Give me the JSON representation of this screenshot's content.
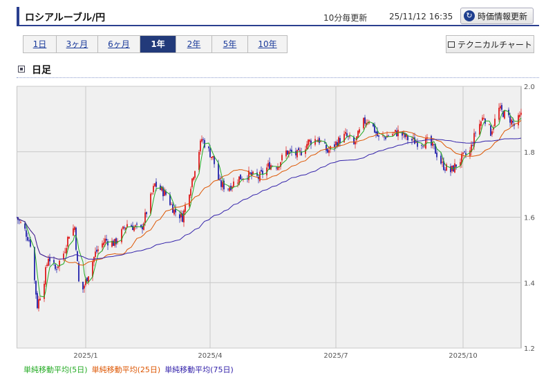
{
  "header": {
    "title": "ロシアルーブル/円",
    "update_note": "10分毎更新",
    "update_time": "25/11/12 16:35",
    "refresh_label": "時価情報更新"
  },
  "tabs": [
    {
      "label": "1日",
      "active": false
    },
    {
      "label": "3ヶ月",
      "active": false
    },
    {
      "label": "6ヶ月",
      "active": false
    },
    {
      "label": "1年",
      "active": true
    },
    {
      "label": "2年",
      "active": false
    },
    {
      "label": "5年",
      "active": false
    },
    {
      "label": "10年",
      "active": false
    }
  ],
  "tech_chart_label": "テクニカルチャート",
  "section_label": "日足",
  "colors": {
    "up": "#dd1111",
    "down": "#1a1aa8",
    "ma5": "#22aa22",
    "ma25": "#dd5500",
    "ma75": "#3322aa",
    "plot_bg": "#f0f0f0"
  },
  "chart_data": {
    "type": "candlestick",
    "ylim": [
      1.2,
      2.0
    ],
    "yticks": [
      "2.0",
      "1.8",
      "1.6",
      "1.4",
      "1.2"
    ],
    "xticks": [
      "2025/1",
      "2025/4",
      "2025/7",
      "2025/10"
    ],
    "grid": true,
    "start": "2024-11-12",
    "end": "2025-11-12",
    "close_path": [
      [
        "2024-11-12",
        1.6
      ],
      [
        "2024-11-18",
        1.56
      ],
      [
        "2024-11-22",
        1.52
      ],
      [
        "2024-11-27",
        1.33
      ],
      [
        "2024-12-02",
        1.41
      ],
      [
        "2024-12-05",
        1.48
      ],
      [
        "2024-12-10",
        1.44
      ],
      [
        "2024-12-16",
        1.49
      ],
      [
        "2024-12-20",
        1.55
      ],
      [
        "2024-12-24",
        1.57
      ],
      [
        "2024-12-27",
        1.4
      ],
      [
        "2024-12-30",
        1.38
      ],
      [
        "2025-01-08",
        1.49
      ],
      [
        "2025-01-15",
        1.53
      ],
      [
        "2025-01-22",
        1.52
      ],
      [
        "2025-01-31",
        1.58
      ],
      [
        "2025-02-10",
        1.56
      ],
      [
        "2025-02-20",
        1.7
      ],
      [
        "2025-02-28",
        1.67
      ],
      [
        "2025-03-06",
        1.62
      ],
      [
        "2025-03-12",
        1.6
      ],
      [
        "2025-03-18",
        1.7
      ],
      [
        "2025-03-26",
        1.84
      ],
      [
        "2025-04-03",
        1.78
      ],
      [
        "2025-04-08",
        1.7
      ],
      [
        "2025-04-14",
        1.69
      ],
      [
        "2025-04-22",
        1.72
      ],
      [
        "2025-04-28",
        1.73
      ],
      [
        "2025-05-06",
        1.72
      ],
      [
        "2025-05-14",
        1.76
      ],
      [
        "2025-05-20",
        1.76
      ],
      [
        "2025-05-26",
        1.8
      ],
      [
        "2025-06-04",
        1.79
      ],
      [
        "2025-06-11",
        1.83
      ],
      [
        "2025-06-18",
        1.84
      ],
      [
        "2025-06-25",
        1.8
      ],
      [
        "2025-07-02",
        1.83
      ],
      [
        "2025-07-08",
        1.85
      ],
      [
        "2025-07-14",
        1.82
      ],
      [
        "2025-07-21",
        1.89
      ],
      [
        "2025-07-25",
        1.9
      ],
      [
        "2025-08-01",
        1.84
      ],
      [
        "2025-08-08",
        1.85
      ],
      [
        "2025-08-15",
        1.86
      ],
      [
        "2025-08-22",
        1.84
      ],
      [
        "2025-08-28",
        1.83
      ],
      [
        "2025-09-05",
        1.83
      ],
      [
        "2025-09-10",
        1.81
      ],
      [
        "2025-09-16",
        1.76
      ],
      [
        "2025-09-22",
        1.74
      ],
      [
        "2025-09-30",
        1.78
      ],
      [
        "2025-10-06",
        1.8
      ],
      [
        "2025-10-10",
        1.86
      ],
      [
        "2025-10-16",
        1.91
      ],
      [
        "2025-10-21",
        1.86
      ],
      [
        "2025-10-27",
        1.93
      ],
      [
        "2025-11-04",
        1.9
      ],
      [
        "2025-11-07",
        1.88
      ],
      [
        "2025-11-12",
        1.91
      ]
    ],
    "series": [
      {
        "name": "単純移動平均(5日)",
        "window": 5
      },
      {
        "name": "単純移動平均(25日)",
        "window": 25
      },
      {
        "name": "単純移動平均(75日)",
        "window": 75
      }
    ]
  }
}
